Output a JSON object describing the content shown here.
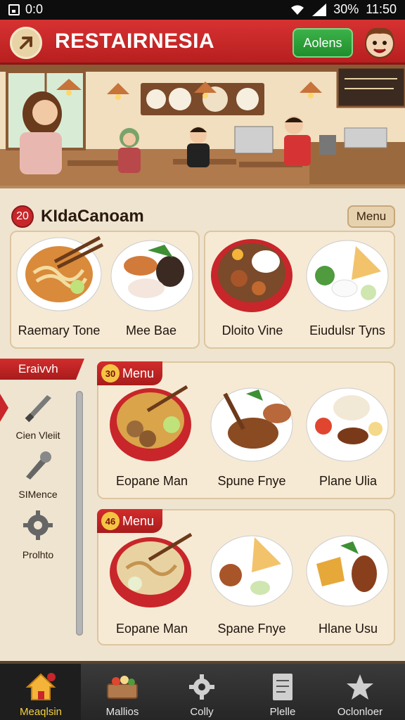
{
  "status_bar": {
    "left_text": "0:0",
    "battery": "30%",
    "time": "11:50"
  },
  "app_bar": {
    "title": "RESTAIRNESIA",
    "action_label": "Aolens"
  },
  "section1": {
    "number": "20",
    "title": "KIdaCanoam",
    "menu_label": "Menu",
    "items": [
      {
        "caption": "Raemary Tone"
      },
      {
        "caption": "Mee Bae"
      },
      {
        "caption": "Dloito Vine"
      },
      {
        "caption": "Eiudulsr Tyns"
      }
    ]
  },
  "sidebar": {
    "tab_label": "Eraivvh",
    "items": [
      {
        "label": "Cien Vleiit",
        "icon": "knife-icon"
      },
      {
        "label": "SIMence",
        "icon": "tools-icon"
      },
      {
        "label": "Prolhto",
        "icon": "gear-icon"
      }
    ]
  },
  "panel1": {
    "number": "30",
    "tag_label": "Menu",
    "items": [
      {
        "caption": "Eopane Man"
      },
      {
        "caption": "Spune Fnye"
      },
      {
        "caption": "Plane Ulia"
      }
    ]
  },
  "panel2": {
    "number": "46",
    "tag_label": "Menu",
    "items": [
      {
        "caption": "Eopane Man"
      },
      {
        "caption": "Spane Fnye"
      },
      {
        "caption": "Hlane Usu"
      }
    ]
  },
  "bottom_nav": {
    "items": [
      {
        "label": "Meaqlsin",
        "icon": "home-icon",
        "active": true
      },
      {
        "label": "Mallios",
        "icon": "basket-icon"
      },
      {
        "label": "Colly",
        "icon": "gear-icon"
      },
      {
        "label": "Plelle",
        "icon": "document-icon"
      },
      {
        "label": "Oclonloer",
        "icon": "star-icon"
      }
    ]
  },
  "colors": {
    "primary_red": "#c8262a",
    "accent_green": "#2a9d38",
    "background": "#efe4d0"
  }
}
